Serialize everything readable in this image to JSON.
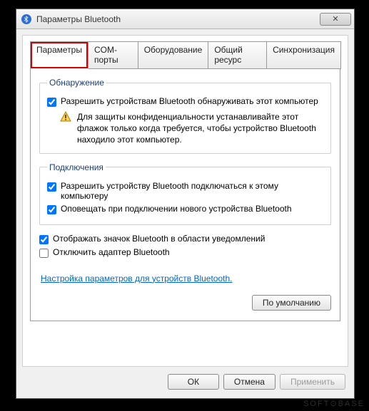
{
  "window": {
    "title": "Параметры Bluetooth",
    "close_glyph": "✕"
  },
  "tabs": [
    {
      "label": "Параметры",
      "active": true
    },
    {
      "label": "COM-порты"
    },
    {
      "label": "Оборудование"
    },
    {
      "label": "Общий ресурс"
    },
    {
      "label": "Синхронизация"
    }
  ],
  "groups": {
    "discovery": {
      "legend": "Обнаружение",
      "allow_discover": {
        "checked": true,
        "label": "Разрешить устройствам Bluetooth обнаруживать этот компьютер"
      },
      "warning": "Для защиты конфиденциальности устанавливайте этот флажок только когда требуется, чтобы устройство Bluetooth находило этот компьютер."
    },
    "connections": {
      "legend": "Подключения",
      "allow_connect": {
        "checked": true,
        "label": "Разрешить устройству Bluetooth подключаться к этому компьютеру"
      },
      "notify_new": {
        "checked": true,
        "label": "Оповещать при подключении нового устройства Bluetooth"
      }
    }
  },
  "options": {
    "tray_icon": {
      "checked": true,
      "label": "Отображать значок Bluetooth в области уведомлений"
    },
    "disable_adapter": {
      "checked": false,
      "label": "Отключить адаптер Bluetooth"
    }
  },
  "link": "Настройка параметров для устройств Bluetooth.",
  "buttons": {
    "defaults": "По умолчанию",
    "ok": "ОК",
    "cancel": "Отмена",
    "apply": "Применить"
  },
  "watermark": "SOFT⊙BASE"
}
